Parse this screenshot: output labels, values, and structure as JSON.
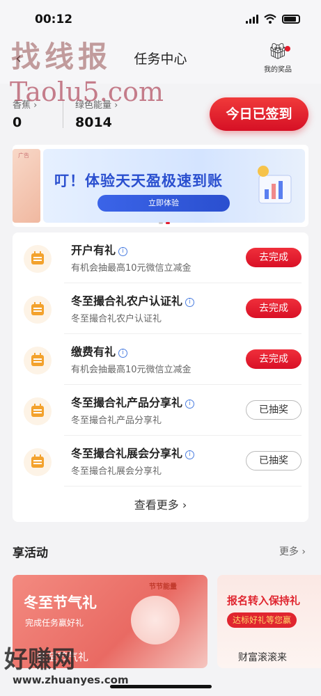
{
  "status": {
    "time": "00:12"
  },
  "header": {
    "title": "任务中心",
    "prize_label": "我的奖品"
  },
  "energy": {
    "left_label": "香蕉",
    "left_value": "0",
    "right_label": "绿色能量",
    "right_value": "8014",
    "sign_button": "今日已签到"
  },
  "banner": {
    "ad_tag": "广告",
    "headline": "叮！体验天天盈极速到账",
    "cta": "立即体验"
  },
  "tasks": [
    {
      "name": "开户有礼",
      "desc": "有机会抽最高10元微信立减金",
      "button": "去完成",
      "state": "go"
    },
    {
      "name": "冬至撮合礼农户认证礼",
      "desc": "冬至撮合礼农户认证礼",
      "button": "去完成",
      "state": "go"
    },
    {
      "name": "缴费有礼",
      "desc": "有机会抽最高10元微信立减金",
      "button": "去完成",
      "state": "go"
    },
    {
      "name": "冬至撮合礼产品分享礼",
      "desc": "冬至撮合礼产品分享礼",
      "button": "已抽奖",
      "state": "done"
    },
    {
      "name": "冬至撮合礼展会分享礼",
      "desc": "冬至撮合礼展会分享礼",
      "button": "已抽奖",
      "state": "done"
    }
  ],
  "more_link": "查看更多",
  "activities": {
    "title": "享活动",
    "more": "更多",
    "card1": {
      "tag": "节节能量",
      "big": "冬至节气礼",
      "small": "完成任务赢好礼",
      "sub": "冬至节气礼"
    },
    "card2": {
      "big": "报名转入保持礼",
      "pill": "达标好礼等您赢",
      "sub": "财富滚滚来"
    }
  },
  "watermarks": {
    "top_cn": "找线报",
    "top_en": "Taolu5.com",
    "bottom_cn": "好赚网",
    "bottom_url": "www.zhuanyes.com"
  }
}
